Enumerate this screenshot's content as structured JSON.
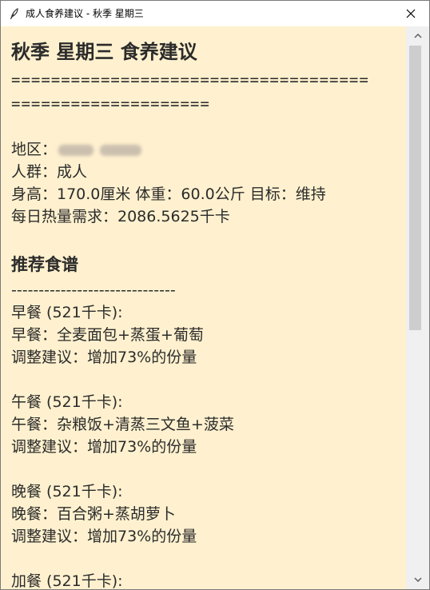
{
  "window": {
    "title": "成人食养建议 - 秋季 星期三"
  },
  "icons": {
    "app": "feather-icon",
    "close": "close-icon",
    "scroll_up": "chevron-up-icon",
    "scroll_down": "chevron-down-icon"
  },
  "report": {
    "title": "秋季 星期三 食养建议",
    "separator_line1": "====================================",
    "separator_line2": "====================",
    "region_label": "地区：",
    "crowd": "人群：成人",
    "body_info": "身高：170.0厘米 体重：60.0公斤 目标：维持",
    "daily_calories": "每日热量需求：2086.5625千卡",
    "recipe_heading": "推荐食谱",
    "recipe_separator": "------------------------------",
    "breakfast": {
      "header": "早餐 (521千卡):",
      "dish": "早餐：全麦面包+蒸蛋+葡萄",
      "advice": "调整建议：增加73%的份量"
    },
    "lunch": {
      "header": "午餐 (521千卡):",
      "dish": "午餐：杂粮饭+清蒸三文鱼+菠菜",
      "advice": "调整建议：增加73%的份量"
    },
    "dinner": {
      "header": "晚餐 (521千卡):",
      "dish": "晚餐：百合粥+蒸胡萝卜",
      "advice": "调整建议：增加73%的份量"
    },
    "snack": {
      "header": "加餐 (521千卡):"
    }
  },
  "colors": {
    "background": "#fff1cf",
    "text": "#2b2b2b"
  }
}
